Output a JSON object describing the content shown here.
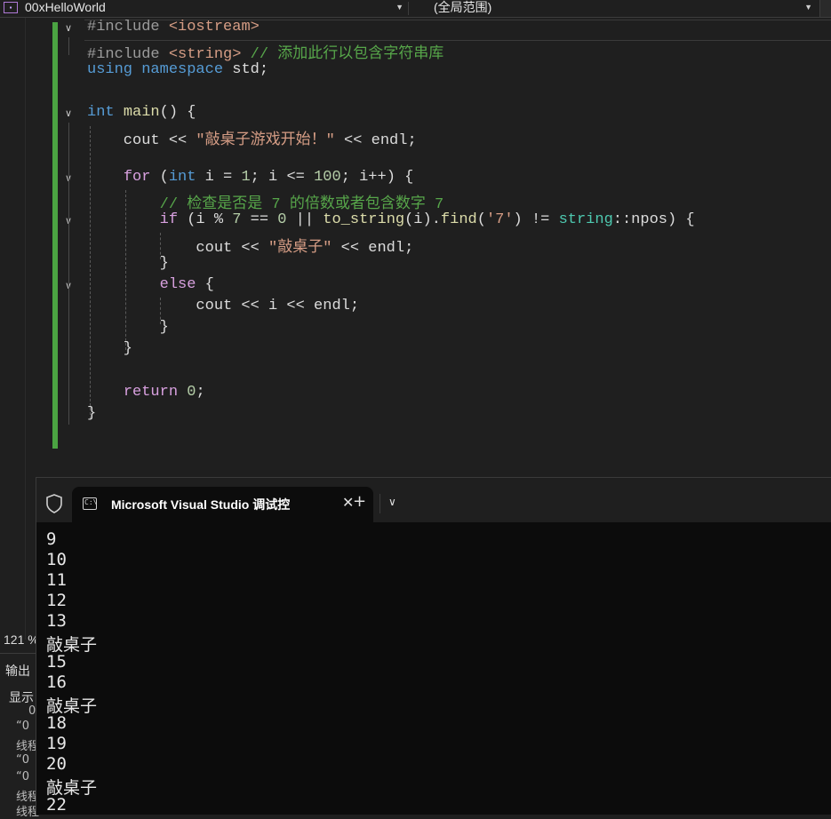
{
  "navbar": {
    "project_icon": "project-icon",
    "project": "00xHelloWorld",
    "scope": "(全局范围)"
  },
  "editor": {
    "lines": [
      {
        "t": "#include <iostream>"
      },
      {
        "t": "#include <string> // 添加此行以包含字符串库"
      },
      {
        "t": "using namespace std;"
      },
      {
        "t": ""
      },
      {
        "t": "int main() {"
      },
      {
        "t": "    cout << \"敲桌子游戏开始！\" << endl;"
      },
      {
        "t": ""
      },
      {
        "t": "    for (int i = 1; i <= 100; i++) {"
      },
      {
        "t": "        // 检查是否是 7 的倍数或者包含数字 7"
      },
      {
        "t": "        if (i % 7 == 0 || to_string(i).find('7') != string::npos) {"
      },
      {
        "t": "            cout << \"敲桌子\" << endl;"
      },
      {
        "t": "        }"
      },
      {
        "t": "        else {"
      },
      {
        "t": "            cout << i << endl;"
      },
      {
        "t": "        }"
      },
      {
        "t": "    }"
      },
      {
        "t": ""
      },
      {
        "t": "    return 0;"
      },
      {
        "t": "}"
      }
    ]
  },
  "status": {
    "zoom": "121 %"
  },
  "tool_window": {
    "output_tab": "输出",
    "show_label": "显示",
    "fragments": [
      "0",
      "“0",
      "线程",
      "“0",
      "“0",
      "线程",
      "线程"
    ]
  },
  "console": {
    "tab_title": "Microsoft Visual Studio 调试控",
    "close_glyph": "✕",
    "new_tab_glyph": "+",
    "dropdown_glyph": "⌄",
    "output": [
      "9",
      "10",
      "11",
      "12",
      "13",
      "敲桌子",
      "15",
      "16",
      "敲桌子",
      "18",
      "19",
      "20",
      "敲桌子",
      "22"
    ]
  },
  "colors": {
    "background": "#1f1f1f",
    "console_bg": "#0c0c0c",
    "change_bar": "#4ba342",
    "keyword": "#569cd6",
    "control": "#d8a0df",
    "comment": "#57a64a",
    "string": "#d69d85"
  }
}
